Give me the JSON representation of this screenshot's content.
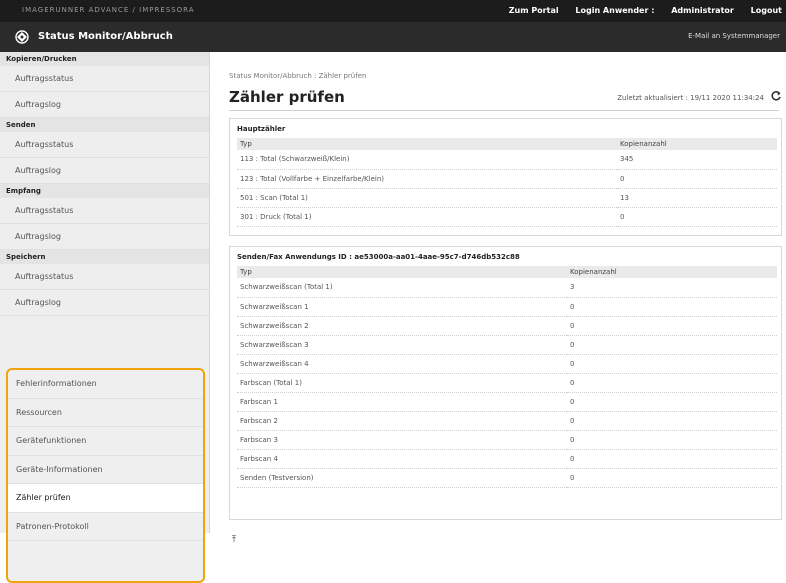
{
  "header": {
    "device_name": "IMAGERUNNER ADVANCE / IMPRESSORA",
    "links": [
      "Zum Portal",
      "Login Anwender :",
      "Administrator",
      "Logout"
    ],
    "app_title": "Status Monitor/Abbruch",
    "mail_link": "E-Mail an Systemmanager"
  },
  "sidebar": {
    "groups": [
      {
        "title": "Kopieren/Drucken",
        "items": [
          "Auftragsstatus",
          "Auftragslog"
        ]
      },
      {
        "title": "Senden",
        "items": [
          "Auftragsstatus",
          "Auftragslog"
        ]
      },
      {
        "title": "Empfang",
        "items": [
          "Auftragsstatus",
          "Auftragslog"
        ]
      },
      {
        "title": "Speichern",
        "items": [
          "Auftragsstatus",
          "Auftragslog"
        ]
      }
    ],
    "highlighted": [
      "Fehlerinformationen",
      "Ressourcen",
      "Gerätefunktionen",
      "Geräte-Informationen",
      "Zähler prüfen",
      "Patronen-Protokoll"
    ]
  },
  "main": {
    "breadcrumb": "Status Monitor/Abbruch : Zähler prüfen",
    "title": "Zähler prüfen",
    "updated": "Zuletzt aktualisiert : 19/11 2020 11:34:24",
    "section1": {
      "title": "Hauptzähler",
      "columns": [
        "Typ",
        "Kopienanzahl"
      ],
      "rows": [
        [
          "113 : Total (Schwarzweiß/Klein)",
          "345"
        ],
        [
          "123 : Total (Vollfarbe + Einzelfarbe/Klein)",
          "0"
        ],
        [
          "501 : Scan (Total 1)",
          "13"
        ],
        [
          "301 : Druck (Total 1)",
          "0"
        ]
      ]
    },
    "section2": {
      "title": "Senden/Fax Anwendungs ID : ae53000a-aa01-4aae-95c7-d746db532c88",
      "columns": [
        "Typ",
        "Kopienanzahl"
      ],
      "rows": [
        [
          "Schwarzweißscan (Total 1)",
          "3"
        ],
        [
          "Schwarzweißscan 1",
          "0"
        ],
        [
          "Schwarzweißscan 2",
          "0"
        ],
        [
          "Schwarzweißscan 3",
          "0"
        ],
        [
          "Schwarzweißscan 4",
          "0"
        ],
        [
          "Farbscan (Total 1)",
          "0"
        ],
        [
          "Farbscan 1",
          "0"
        ],
        [
          "Farbscan 2",
          "0"
        ],
        [
          "Farbscan 3",
          "0"
        ],
        [
          "Farbscan 4",
          "0"
        ],
        [
          "Senden (Testversion)",
          "0"
        ]
      ]
    }
  },
  "colors": {
    "accent": "#f0a30a",
    "topbar": "#1c1c1c",
    "titlebar": "#2b2b2b"
  }
}
